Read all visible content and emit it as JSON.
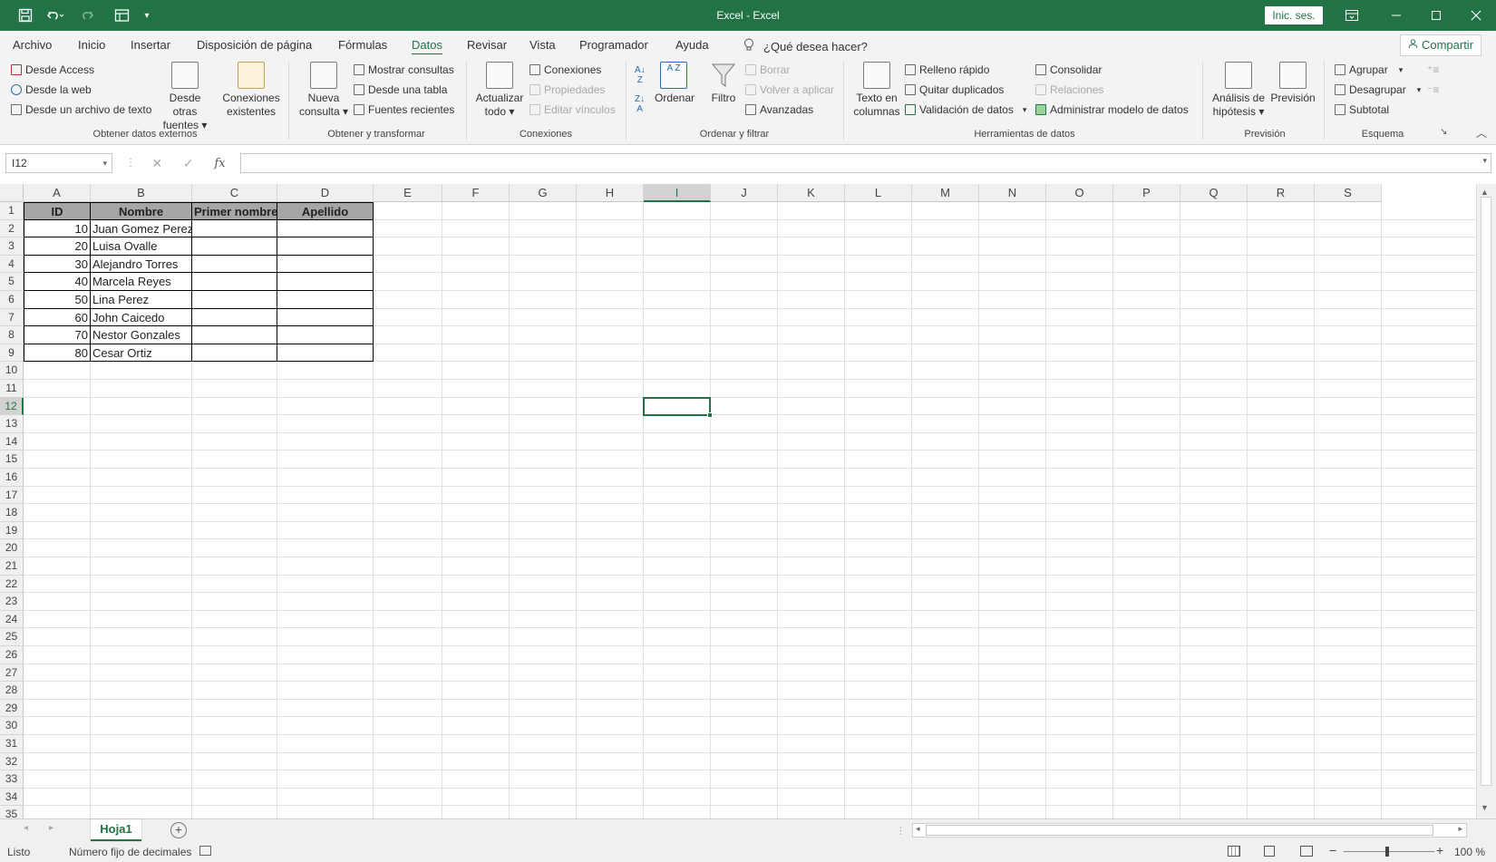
{
  "titlebar": {
    "title": "Excel - Excel",
    "sign_in": "Inic. ses."
  },
  "tabs": [
    "Archivo",
    "Inicio",
    "Insertar",
    "Disposición de página",
    "Fórmulas",
    "Datos",
    "Revisar",
    "Vista",
    "Programador",
    "Ayuda"
  ],
  "active_tab": "Datos",
  "tell_me": "¿Qué desea hacer?",
  "share": "Compartir",
  "ribbon": {
    "external": {
      "access": "Desde Access",
      "web": "Desde la web",
      "text": "Desde un archivo de texto",
      "other_sources_1": "Desde otras",
      "other_sources_2": "fuentes",
      "existing_1": "Conexiones",
      "existing_2": "existentes",
      "group": "Obtener datos externos"
    },
    "transform": {
      "new_query_1": "Nueva",
      "new_query_2": "consulta",
      "show_queries": "Mostrar consultas",
      "from_table": "Desde una tabla",
      "recent": "Fuentes recientes",
      "group": "Obtener y transformar"
    },
    "connections": {
      "refresh_1": "Actualizar",
      "refresh_2": "todo",
      "connections": "Conexiones",
      "properties": "Propiedades",
      "edit_links": "Editar vínculos",
      "group": "Conexiones"
    },
    "sort": {
      "sort_az": "A Z",
      "sort": "Ordenar",
      "filter": "Filtro",
      "clear": "Borrar",
      "reapply": "Volver a aplicar",
      "advanced": "Avanzadas",
      "group": "Ordenar y filtrar"
    },
    "tools": {
      "text_to_cols_1": "Texto en",
      "text_to_cols_2": "columnas",
      "flash_fill": "Relleno rápido",
      "remove_dups": "Quitar duplicados",
      "validation": "Validación de datos",
      "consolidate": "Consolidar",
      "relations": "Relaciones",
      "data_model": "Administrar modelo de datos",
      "group": "Herramientas de datos"
    },
    "forecast": {
      "whatif_1": "Análisis de",
      "whatif_2": "hipótesis",
      "forecast": "Previsión",
      "group": "Previsión"
    },
    "outline": {
      "group_btn": "Agrupar",
      "ungroup": "Desagrupar",
      "subtotal": "Subtotal",
      "group": "Esquema"
    }
  },
  "formula_bar": {
    "name_box": "I12",
    "fx": "fx",
    "formula": ""
  },
  "columns": [
    "A",
    "B",
    "C",
    "D",
    "E",
    "F",
    "G",
    "H",
    "I",
    "J",
    "K",
    "L",
    "M",
    "N",
    "O",
    "P",
    "Q",
    "R",
    "S"
  ],
  "rows": [
    "1",
    "2",
    "3",
    "4",
    "5",
    "6",
    "7",
    "8",
    "9",
    "10",
    "11",
    "12",
    "13",
    "14",
    "15",
    "16",
    "17",
    "18",
    "19",
    "20",
    "21",
    "22",
    "23",
    "24",
    "25",
    "26",
    "27",
    "28",
    "29",
    "30",
    "31",
    "32",
    "33",
    "34",
    "35"
  ],
  "selected": {
    "column": "I",
    "row": "12"
  },
  "table": {
    "headers": [
      "ID",
      "Nombre",
      "Primer nombre",
      "Apellido"
    ],
    "rows": [
      [
        "10",
        "Juan Gomez Perez",
        "",
        ""
      ],
      [
        "20",
        "Luisa Ovalle",
        "",
        ""
      ],
      [
        "30",
        "Alejandro Torres",
        "",
        ""
      ],
      [
        "40",
        "Marcela Reyes",
        "",
        ""
      ],
      [
        "50",
        "Lina Perez",
        "",
        ""
      ],
      [
        "60",
        "John Caicedo",
        "",
        ""
      ],
      [
        "70",
        "Nestor Gonzales",
        "",
        ""
      ],
      [
        "80",
        "Cesar Ortiz",
        "",
        ""
      ]
    ]
  },
  "sheets": [
    "Hoja1"
  ],
  "status": {
    "ready": "Listo",
    "fixed_decimal": "Número fijo de decimales",
    "zoom": "100 %"
  },
  "colors": {
    "accent": "#217346",
    "header_fill": "#a6a6a6"
  }
}
